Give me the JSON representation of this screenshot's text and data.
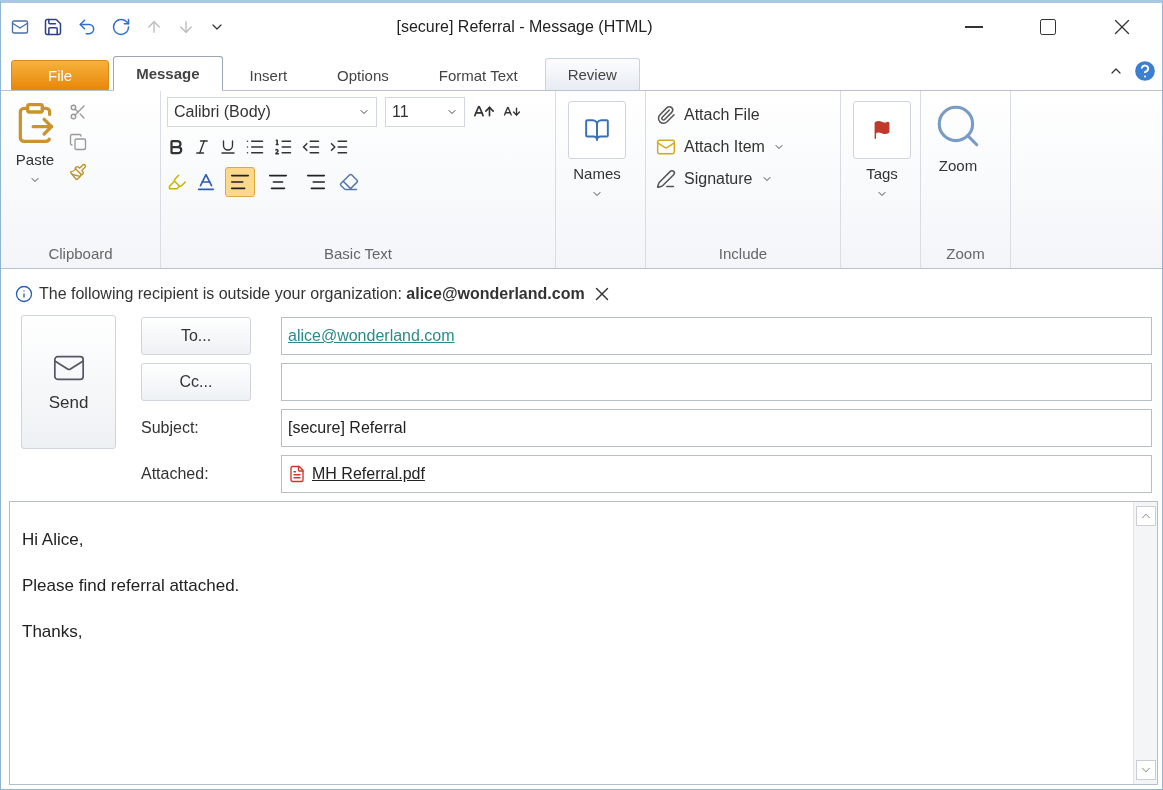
{
  "window": {
    "title": "[secure] Referral  -  Message (HTML)"
  },
  "tabs": [
    {
      "label": "File",
      "kind": "file",
      "selected": false,
      "outlined": false
    },
    {
      "label": "Message",
      "kind": "tab",
      "selected": true,
      "outlined": false
    },
    {
      "label": "Insert",
      "kind": "tab",
      "selected": false,
      "outlined": false
    },
    {
      "label": "Options",
      "kind": "tab",
      "selected": false,
      "outlined": false
    },
    {
      "label": "Format Text",
      "kind": "tab",
      "selected": false,
      "outlined": false
    },
    {
      "label": "Review",
      "kind": "tab",
      "selected": false,
      "outlined": true
    }
  ],
  "ribbon": {
    "clipboard": {
      "label": "Clipboard",
      "paste": "Paste"
    },
    "basic_text": {
      "label": "Basic Text",
      "font": "Calibri (Body)",
      "size": "11",
      "alignment": [
        {
          "selected": true
        },
        {
          "selected": false
        },
        {
          "selected": false
        }
      ]
    },
    "names": {
      "label": "Names"
    },
    "include": {
      "label": "Include",
      "items": [
        {
          "label": "Attach File",
          "dropdown": false
        },
        {
          "label": "Attach Item",
          "dropdown": true
        },
        {
          "label": "Signature",
          "dropdown": true
        }
      ]
    },
    "tags": {
      "label": "Tags"
    },
    "zoom": {
      "label": "Zoom",
      "button": "Zoom"
    }
  },
  "infobar": {
    "text": "The following recipient is outside your organization: **alice@wonderland.com**"
  },
  "header": {
    "send": "Send",
    "to": {
      "button": "To...",
      "recipient": "alice@wonderland.com"
    },
    "cc": {
      "button": "Cc..."
    },
    "subject": {
      "label": "Subject:",
      "value": "[secure] Referral"
    },
    "attached": {
      "label": "Attached:",
      "file": "MH Referral.pdf"
    }
  },
  "body": {
    "lines": [
      "Hi Alice,",
      "Please find referral attached.",
      "Thanks,"
    ]
  }
}
